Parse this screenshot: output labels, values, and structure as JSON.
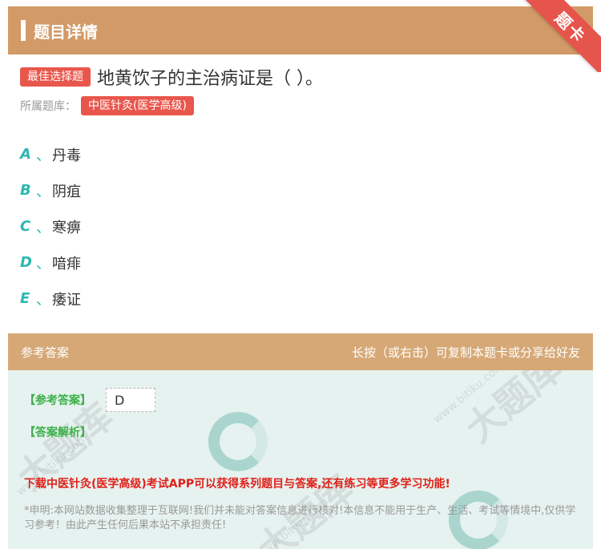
{
  "header": {
    "title": "题目详情",
    "ribbon": "题卡"
  },
  "question": {
    "type_tag": "最佳选择题",
    "text": "地黄饮子的主治病证是（ ）。",
    "bank_label": "所属题库：",
    "bank_tag": "中医针灸(医学高级)"
  },
  "options": [
    {
      "letter": "A",
      "sep": "、",
      "text": "丹毒"
    },
    {
      "letter": "B",
      "sep": "、",
      "text": "阴疽"
    },
    {
      "letter": "C",
      "sep": "、",
      "text": "寒痹"
    },
    {
      "letter": "D",
      "sep": "、",
      "text": "喑痱"
    },
    {
      "letter": "E",
      "sep": "、",
      "text": "痿证"
    }
  ],
  "answer_section": {
    "title": "参考答案",
    "hint": "长按（或右击）可复制本题卡或分享给好友",
    "answer_label": "【参考答案】",
    "answer_value": "D",
    "analysis_label": "【答案解析】",
    "promo": "下载中医针灸(医学高级)考试APP可以获得系列题目与答案,还有练习等更多学习功能!",
    "disclaimer": "*申明:本网站数据收集整理于互联网!我们并未能对答案信息进行核对!本信息不能用于生产、生活、考试等情境中,仅供学习参考！由此产生任何后果本站不承担责任!"
  },
  "watermark": {
    "text": "大题库",
    "domain": "www.bitiku.com"
  },
  "colors": {
    "header_bg": "#d29a66",
    "ribbon": "#e6554c",
    "tag": "#e9564c",
    "option_letter": "#2bb8b1",
    "answer_label": "#3cb14a",
    "promo": "#e0201a"
  }
}
